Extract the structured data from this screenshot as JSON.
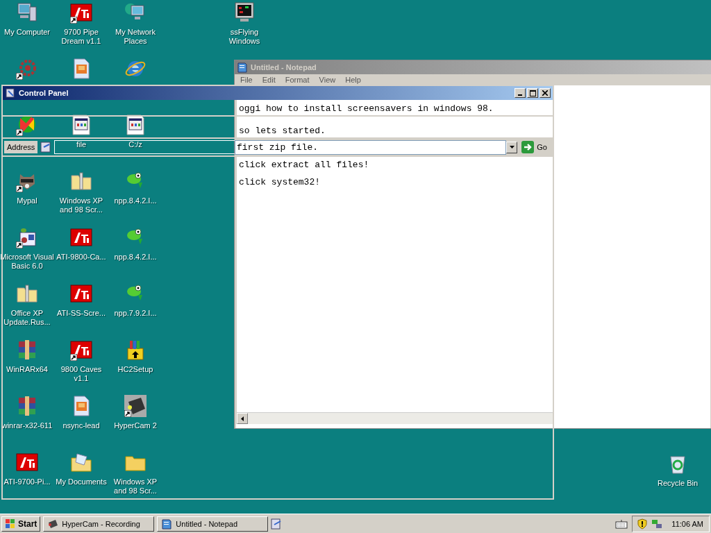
{
  "desktop": {
    "icons": [
      {
        "label": "My Computer",
        "kind": "computer",
        "shortcut": false
      },
      {
        "kind": "gear",
        "shortcut": true
      },
      {
        "kind": "pinwheel",
        "shortcut": true
      },
      {
        "label": "Mypal",
        "kind": "raccoon",
        "shortcut": true
      },
      {
        "label": "Microsoft Visual Basic 6.0",
        "kind": "vb",
        "shortcut": true
      },
      {
        "label": "Office XP Update.Rus...",
        "kind": "zipfolder",
        "shortcut": false
      },
      {
        "label": "WinRARx64",
        "kind": "winrar",
        "shortcut": false
      },
      {
        "label": "winrar-x32-611",
        "kind": "winrar",
        "shortcut": false
      },
      {
        "label": "ATI-9700-Pi...",
        "kind": "ati",
        "shortcut": false
      },
      {
        "label": "9700 Pipe Dream v1.1",
        "kind": "ati",
        "shortcut": true
      },
      {
        "kind": "document",
        "shortcut": false
      },
      {
        "label": "file",
        "kind": "window",
        "shortcut": false
      },
      {
        "label": "Windows XP and 98 Scr...",
        "kind": "zipfolder",
        "shortcut": false
      },
      {
        "label": "ATI-9800-Ca...",
        "kind": "ati",
        "shortcut": false
      },
      {
        "label": "ATI-SS-Scre...",
        "kind": "ati",
        "shortcut": false
      },
      {
        "label": "9800 Caves v1.1",
        "kind": "ati",
        "shortcut": true
      },
      {
        "label": "nsync-lead",
        "kind": "document",
        "shortcut": false
      },
      {
        "label": "My Documents",
        "kind": "mydocs",
        "shortcut": false
      },
      {
        "label": "My Network Places",
        "kind": "network",
        "shortcut": false
      },
      {
        "kind": "ie",
        "shortcut": false
      },
      {
        "label": "C:/z",
        "kind": "window",
        "shortcut": false
      },
      {
        "label": "npp.8.4.2.I...",
        "kind": "chameleon",
        "shortcut": false
      },
      {
        "label": "npp.8.4.2.I...",
        "kind": "chameleon",
        "shortcut": false
      },
      {
        "label": "npp.7.9.2.I...",
        "kind": "chameleon",
        "shortcut": false
      },
      {
        "label": "HC2Setup",
        "kind": "installer",
        "shortcut": false
      },
      {
        "label": "HyperCam 2",
        "kind": "camera",
        "shortcut": true
      },
      {
        "label": "Windows XP and 98 Scr...",
        "kind": "folder",
        "shortcut": false
      }
    ],
    "extra_icons": [
      {
        "label": "ssFlying Windows",
        "kind": "monitor",
        "shortcut": false
      },
      {
        "label": "Recycle Bin",
        "kind": "recycle",
        "shortcut": false
      }
    ]
  },
  "notepad": {
    "title": "Untitled - Notepad",
    "active": false,
    "menu": [
      "File",
      "Edit",
      "Format",
      "View",
      "Help"
    ]
  },
  "control_panel": {
    "title": "Control Panel",
    "active": true,
    "address_label": "Address",
    "go": "Go",
    "lines": [
      "oggi how to install screensavers in windows 98.",
      "so lets started.",
      "first zip file.",
      "click extract all files!",
      "click system32!"
    ]
  },
  "taskbar": {
    "start": "Start",
    "tasks": [
      {
        "label": "HyperCam - Recording",
        "kind": "camera",
        "selected": false
      },
      {
        "label": "Untitled - Notepad",
        "kind": "notepad",
        "selected": false
      }
    ],
    "clock": "11:06 AM"
  }
}
